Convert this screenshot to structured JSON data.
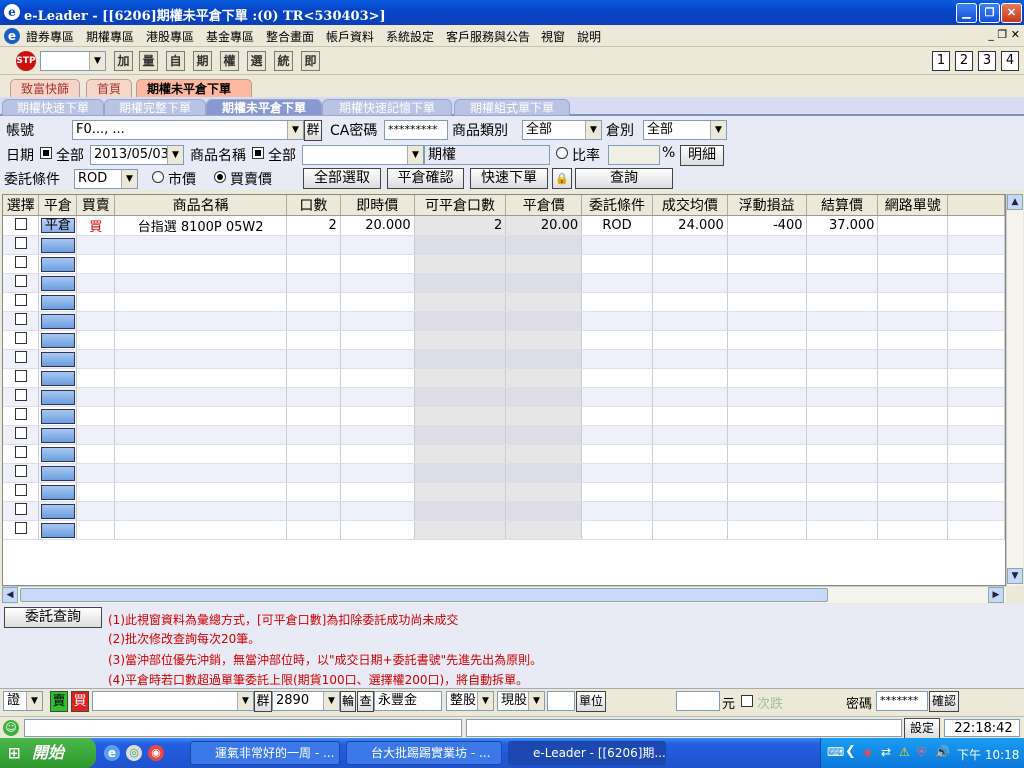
{
  "window": {
    "title": "e-Leader - [[6206]期權未平倉下單 :(0) TR<530403>]",
    "icon": "e-leader-icon"
  },
  "menu": [
    "證券專區",
    "期權專區",
    "港股專區",
    "基金專區",
    "整合畫面",
    "帳戶資料",
    "系統設定",
    "客戶服務與公告",
    "視窗",
    "說明"
  ],
  "toolbar": {
    "buttons": [
      "加",
      "量",
      "自",
      "期",
      "權",
      "選",
      "統",
      "即"
    ],
    "pages": [
      "1",
      "2",
      "3",
      "4"
    ]
  },
  "tabs_top": [
    {
      "label": "致富快篩"
    },
    {
      "label": "首頁"
    },
    {
      "label": "期權未平倉下單"
    }
  ],
  "tabs_sub": [
    {
      "label": "期權快速下單"
    },
    {
      "label": "期權完整下單"
    },
    {
      "label": "期權未平倉下單"
    },
    {
      "label": "期權快速記憶下單"
    },
    {
      "label": "期權組式單下單"
    }
  ],
  "form": {
    "account_label": "帳號",
    "account_value": "F0..., ...",
    "group_btn": "群",
    "ca_label": "CA密碼",
    "ca_value": "*********",
    "category_label": "商品類別",
    "category_value": "全部",
    "warehouse_label": "倉別",
    "warehouse_value": "全部",
    "date_label": "日期",
    "date_all": "全部",
    "date_value": "2013/05/03",
    "product_label": "商品名稱",
    "product_all": "全部",
    "product_type_btn": "期權",
    "ratio_label": "比率",
    "pct": "%",
    "detail_btn": "明細",
    "condition_label": "委託條件",
    "condition_value": "ROD",
    "market_label": "市價",
    "bidask_label": "買賣價",
    "select_all_btn": "全部選取",
    "confirm_close_btn": "平倉確認",
    "quick_order_btn": "快速下單",
    "query_btn": "查詢"
  },
  "grid": {
    "headers": [
      "選擇",
      "平倉",
      "買賣",
      "商品名稱",
      "口數",
      "即時價",
      "可平倉口數",
      "平倉價",
      "委託條件",
      "成交均價",
      "浮動損益",
      "結算價",
      "網路單號"
    ],
    "rows": [
      {
        "select": "",
        "close_btn": "平倉",
        "side": "買",
        "product": "台指選 8100P 05W2",
        "qty": "2",
        "price": "20.000",
        "closable": "2",
        "close_price": "20.00",
        "condition": "ROD",
        "avg_price": "24.000",
        "pnl": "-400",
        "settle": "37.000",
        "order_no": ""
      }
    ],
    "empty_rows": 16
  },
  "notes": {
    "query_btn": "委託查詢",
    "lines": [
      "(1)此視窗資料為彙總方式，[可平倉口數]為扣除委託成功尚未成交",
      "(2)批次修改查詢每次20筆。",
      "(3)當沖部位優先沖銷，無當沖部位時，以\"成交日期+委託書號\"先進先出為原則。",
      "(4)平倉時若口數超過單筆委託上限(期貨100口、選擇權200口)，將自動拆單。"
    ]
  },
  "orderbar": {
    "type": "證",
    "buy": "賣",
    "sell": "買",
    "account": "",
    "group": "群",
    "stock": "2890",
    "wheel": "輪",
    "check": "查",
    "stock_name": "永豐金",
    "lot": "整股",
    "mode": "現股",
    "unit": "單位",
    "currency": "元",
    "limit_label": "次跌",
    "pwd_label": "密碼",
    "pwd": "*******",
    "confirm": "確認"
  },
  "status": {
    "settings": "設定",
    "time": "22:18:42"
  },
  "taskbar": {
    "start": "開始",
    "tasks": [
      "運氣非常好的一周 - ...",
      "台大批踢踢實業坊 - ...",
      "e-Leader - [[6206]期..."
    ],
    "clock": "下午 10:18"
  }
}
